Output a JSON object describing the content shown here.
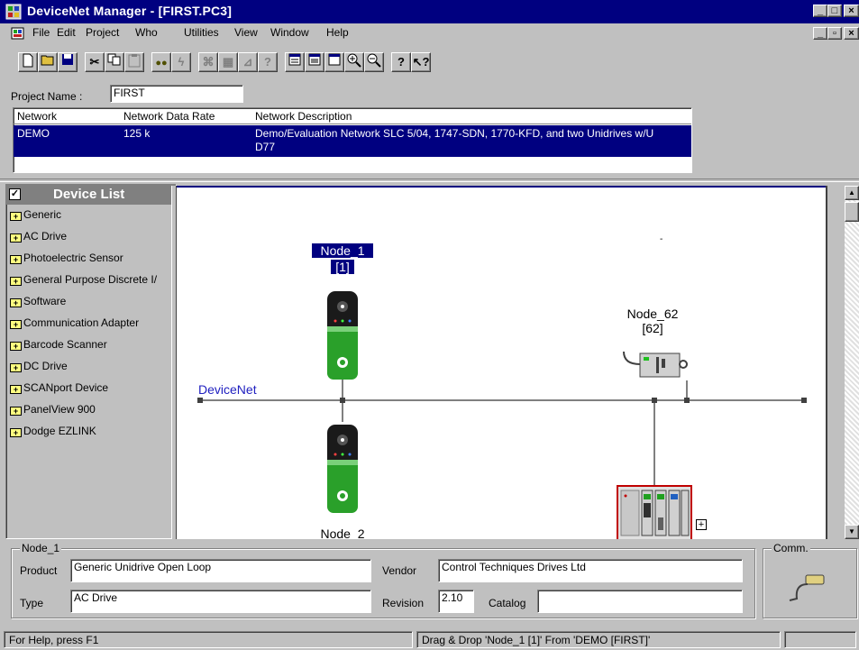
{
  "window": {
    "title": "DeviceNet Manager - [FIRST.PC3]"
  },
  "menu": {
    "items": [
      "File",
      "Edit",
      "Project",
      "Who",
      "Utilities",
      "View",
      "Window",
      "Help"
    ]
  },
  "toolbar": {
    "buttons": [
      "new",
      "open",
      "save",
      "cut",
      "copy",
      "paste",
      "who",
      "online",
      "scanlist",
      "edit-device",
      "wizard",
      "wizard2",
      "view-list",
      "view-graph",
      "view-window",
      "zoom-in",
      "zoom-out",
      "help",
      "context-help"
    ]
  },
  "project": {
    "name_label": "Project Name :",
    "name_value": "FIRST"
  },
  "network_table": {
    "headers": [
      "Network",
      "Network Data Rate",
      "Network Description"
    ],
    "rows": [
      {
        "network": "DEMO",
        "rate": "125 k",
        "description_line1": "Demo/Evaluation Network SLC 5/04, 1747-SDN, 1770-KFD, and two Unidrives w/U",
        "description_line2": "D77"
      }
    ]
  },
  "device_list": {
    "title": "Device List",
    "items": [
      "Generic",
      "AC Drive",
      "Photoelectric Sensor",
      "General Purpose Discrete I/",
      "Software",
      "Communication Adapter",
      "Barcode Scanner",
      "DC Drive",
      "SCANport Device",
      "PanelView 900",
      "Dodge EZLINK"
    ]
  },
  "canvas": {
    "network_label": "DeviceNet",
    "node1_name": "Node_1",
    "node1_addr": "[1]",
    "node2_name": "Node_2",
    "node62_name": "Node_62",
    "node62_addr": "[62]",
    "expand_symbol": "+",
    "dot": "-"
  },
  "details": {
    "group_title": "Node_1",
    "product_label": "Product",
    "product_value": "Generic Unidrive Open Loop",
    "vendor_label": "Vendor",
    "vendor_value": "Control Techniques Drives Ltd",
    "type_label": "Type",
    "type_value": "AC Drive",
    "revision_label": "Revision",
    "revision_value": "2.10",
    "catalog_label": "Catalog",
    "catalog_value": "",
    "comm_title": "Comm."
  },
  "status": {
    "help_text": "For Help, press F1",
    "drag_text": "Drag & Drop 'Node_1 [1]' From 'DEMO [FIRST]'"
  },
  "colors": {
    "titlebar": "#000080",
    "selection": "#000080",
    "drive_green": "#2aa02a",
    "drive_dark": "#1a1a1a",
    "network_label": "#2020c0",
    "plc_border": "#c00000"
  }
}
